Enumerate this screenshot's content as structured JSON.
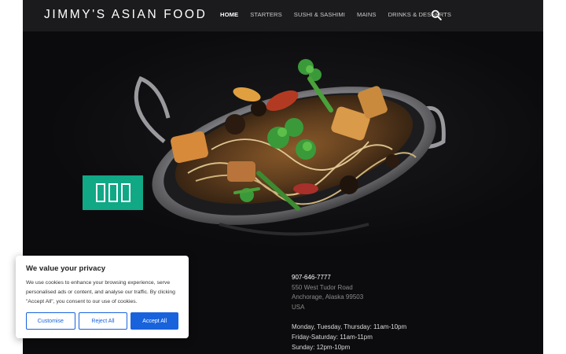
{
  "header": {
    "brand": "JIMMY'S ASIAN FOOD",
    "nav": [
      {
        "label": "HOME",
        "active": true
      },
      {
        "label": "STARTERS",
        "active": false
      },
      {
        "label": "SUSHI & SASHIMI",
        "active": false
      },
      {
        "label": "MAINS",
        "active": false
      },
      {
        "label": "DRINKS & DESSERTS",
        "active": false
      }
    ],
    "search_icon": "search-icon"
  },
  "hero": {
    "image": "noodle-stir-fry-in-steel-pan",
    "badge_color": "#11a886"
  },
  "info": {
    "phone": "907-646-7777",
    "address_line1": "550 West Tudor Road",
    "address_line2": "Anchorage, Alaska 99503",
    "country": "USA",
    "hours": [
      "Monday, Tuesday, Thursday: 11am-10pm",
      "Friday-Saturday: 11am-11pm",
      "Sunday: 12pm-10pm"
    ]
  },
  "cookie": {
    "title": "We value your privacy",
    "text": "We use cookies to enhance your browsing experience, serve personalised ads or content, and analyse our traffic. By clicking \"Accept All\", you consent to our use of cookies.",
    "customise_label": "Customise",
    "reject_label": "Reject All",
    "accept_label": "Accept All",
    "accent_color": "#1863dc"
  }
}
